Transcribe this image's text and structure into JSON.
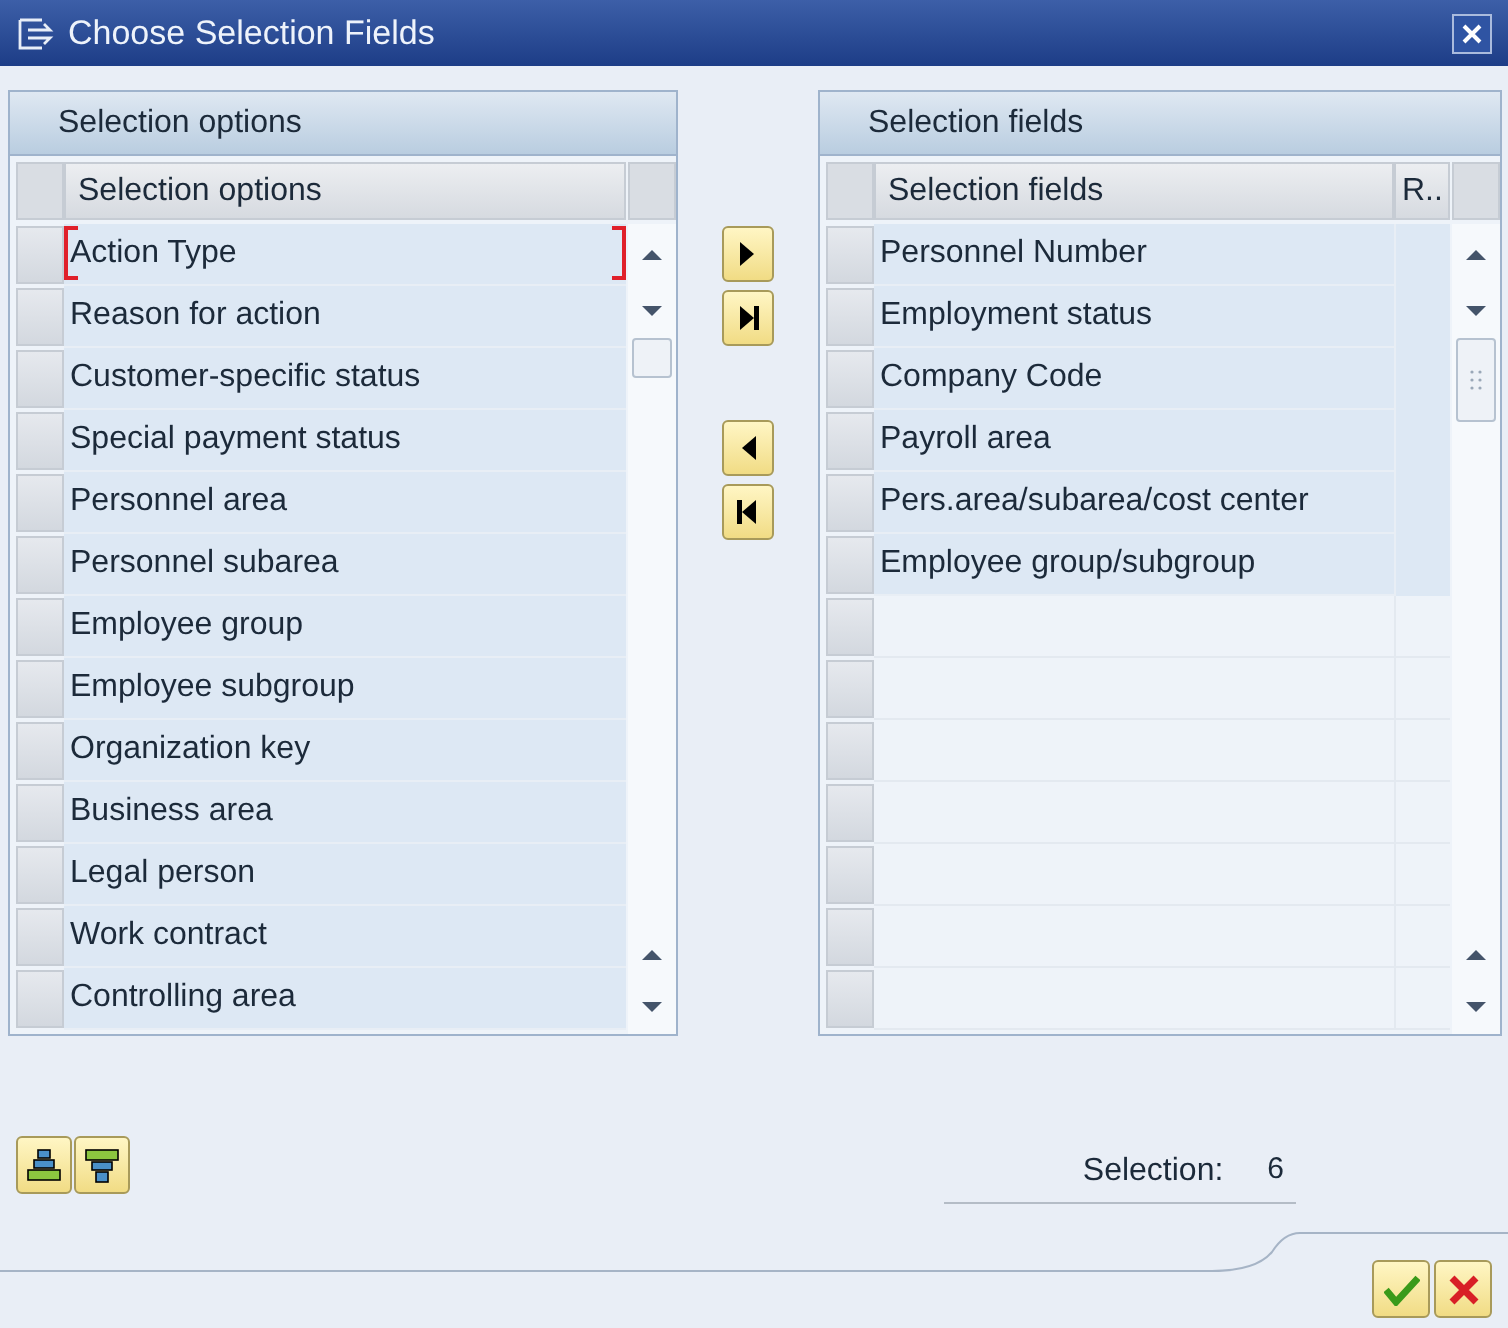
{
  "window": {
    "title": "Choose Selection Fields"
  },
  "left_panel": {
    "title": "Selection options",
    "column": "Selection options",
    "rows": [
      {
        "label": "Action Type",
        "focused": true
      },
      {
        "label": "Reason for action",
        "focused": false
      },
      {
        "label": "Customer-specific status",
        "focused": false
      },
      {
        "label": "Special payment status",
        "focused": false
      },
      {
        "label": "Personnel area",
        "focused": false
      },
      {
        "label": "Personnel subarea",
        "focused": false
      },
      {
        "label": "Employee group",
        "focused": false
      },
      {
        "label": "Employee subgroup",
        "focused": false
      },
      {
        "label": "Organization key",
        "focused": false
      },
      {
        "label": "Business area",
        "focused": false
      },
      {
        "label": "Legal person",
        "focused": false
      },
      {
        "label": "Work contract",
        "focused": false
      },
      {
        "label": "Controlling area",
        "focused": false
      }
    ]
  },
  "right_panel": {
    "title": "Selection fields",
    "columns": [
      "Selection fields",
      "R.."
    ],
    "rows": [
      {
        "label": "Personnel Number"
      },
      {
        "label": "Employment status"
      },
      {
        "label": "Company Code"
      },
      {
        "label": "Payroll area"
      },
      {
        "label": "Pers.area/subarea/cost center"
      },
      {
        "label": "Employee group/subgroup"
      }
    ]
  },
  "selection": {
    "label": "Selection:",
    "value": "6"
  }
}
